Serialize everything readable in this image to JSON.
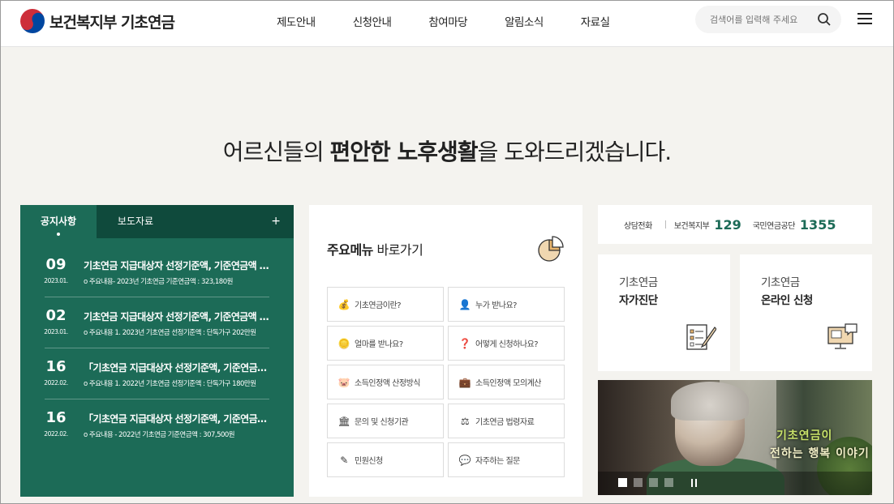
{
  "header": {
    "logo_text": "보건복지부 기초연금",
    "nav": [
      "제도안내",
      "신청안내",
      "참여마당",
      "알림소식",
      "자료실"
    ],
    "search_placeholder": "검색어를 입력해 주세요"
  },
  "hero": {
    "pre": "어르신들의 ",
    "bold": "편안한 노후생활",
    "post": "을 도와드리겠습니다."
  },
  "notice": {
    "tabs": [
      "공지사항",
      "보도자료"
    ],
    "more": "+",
    "items": [
      {
        "day": "09",
        "ym": "2023.01.",
        "title": "기초연금 지급대상자 선정기준액, 기준연금액 변경 안내",
        "desc": "o 주요내용- 2023년 기초연금 기준연금액 : 323,180원"
      },
      {
        "day": "02",
        "ym": "2023.01.",
        "title": "기초연금 지급대상자 선정기준액, 기준연금액 안내",
        "desc": "o 주요내용 1. 2023년 기초연금 선정기준액 : 단독가구 202만원"
      },
      {
        "day": "16",
        "ym": "2022.02.",
        "title": "「기초연금 지급대상자 선정기준액, 기준연금액 고시」",
        "desc": "o 주요내용 1. 2022년 기초연금 선정기준액 : 단독가구 180만원"
      },
      {
        "day": "16",
        "ym": "2022.02.",
        "title": "「기초연금 지급대상자 선정기준액, 기준연금액 고시」",
        "desc": "o 주요내용 - 2022년 기초연금 기준연금액 : 307,500원"
      }
    ]
  },
  "main_menu": {
    "title_bold": "주요메뉴",
    "title_rest": " 바로가기",
    "buttons": [
      {
        "label": "기초연금이란?",
        "icon": "coins-icon"
      },
      {
        "label": "누가 받나요?",
        "icon": "person-icon"
      },
      {
        "label": "얼마를 받나요?",
        "icon": "coin-stack-icon"
      },
      {
        "label": "어떻게 신청하나요?",
        "icon": "question-coin-icon"
      },
      {
        "label": "소득인정액 산정방식",
        "icon": "piggy-bank-icon"
      },
      {
        "label": "소득인정액 모의계산",
        "icon": "money-bag-icon"
      },
      {
        "label": "문의 및 신청기관",
        "icon": "building-icon"
      },
      {
        "label": "기초연금 법령자료",
        "icon": "gavel-icon"
      },
      {
        "label": "민원신청",
        "icon": "pen-icon"
      },
      {
        "label": "자주하는 질문",
        "icon": "faq-icon"
      }
    ]
  },
  "tel": {
    "label": "상담전화",
    "org1": "보건복지부",
    "num1": "129",
    "org2": "국민연금공단",
    "num2": "1355"
  },
  "cards": [
    {
      "line1": "기초연금",
      "line2": "자가진단",
      "icon": "checklist-icon"
    },
    {
      "line1": "기초연금",
      "line2": "온라인 신청",
      "icon": "computer-icon"
    }
  ],
  "video": {
    "caption_line1": "기초연금이",
    "caption_line2": "전하는 행복 이야기"
  },
  "colors": {
    "accent_green": "#1c6b57",
    "tab_dark_green": "#0f4a3c"
  }
}
